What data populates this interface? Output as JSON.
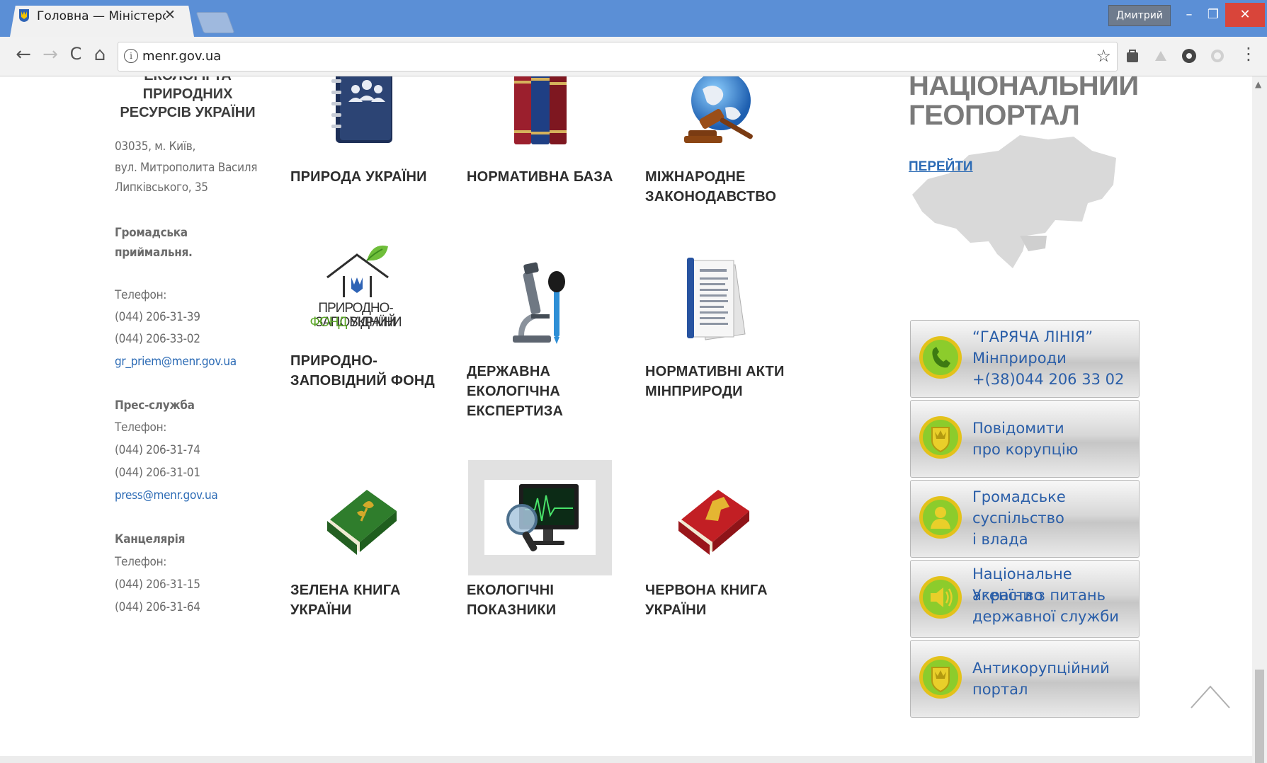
{
  "browser": {
    "tab_title": "Головна — Міністерство",
    "tab_close": "✕",
    "user_name": "Дмитрий",
    "window_minimize": "–",
    "window_restore": "❐",
    "window_close": "✕",
    "url": "menr.gov.ua",
    "nav": {
      "back": "←",
      "forward": "→",
      "reload": "C",
      "home": "⌂"
    },
    "info_glyph": "i",
    "star": "☆",
    "menu": "⋮"
  },
  "sidebar": {
    "org_name": "ЕКОЛОГІЇ ТА ПРИРОДНИХ РЕСУРСІВ УКРАЇНИ",
    "address_lines": [
      "03035, м. Київ,",
      "вул. Митрополита Василя",
      "Липківського, 35"
    ],
    "reception_title_1": "Громадська",
    "reception_title_2": "приймальня.",
    "phone_label": "Телефон:",
    "reception_phones": [
      "(044) 206-31-39",
      "(044) 206-33-02"
    ],
    "reception_email": "gr_priem@menr.gov.ua",
    "press_title": "Прес-служба",
    "press_phones": [
      "(044) 206-31-74",
      "(044) 206-31-01"
    ],
    "press_email": "press@menr.gov.ua",
    "office_title": "Канцелярія",
    "office_phones": [
      "(044) 206-31-15",
      "(044) 206-31-64"
    ]
  },
  "tiles": [
    {
      "label": "ПРИРОДА УКРАЇНИ",
      "icon": "address-book-icon"
    },
    {
      "label": "НОРМАТИВНА БАЗА",
      "icon": "books-icon"
    },
    {
      "label": "МІЖНАРОДНЕ ЗАКОНОДАВСТВО",
      "icon": "globe-gavel-icon"
    },
    {
      "label": "ПРИРОДНО-ЗАПОВІДНИЙ ФОНД",
      "icon": "reserve-fund-logo",
      "logo_line1": "ПРИРОДНО-ЗАПОВІДНИЙ",
      "logo_line2a": "ФОНД",
      "logo_line2b": " УКРАЇНИ"
    },
    {
      "label": "ДЕРЖАВНА ЕКОЛОГІЧНА ЕКСПЕРТИЗА",
      "icon": "microscope-icon"
    },
    {
      "label": "НОРМАТИВНІ АКТИ МІНПРИРОДИ",
      "icon": "documents-icon"
    },
    {
      "label": "ЗЕЛЕНА КНИГА УКРАЇНИ",
      "icon": "green-book-icon"
    },
    {
      "label": "ЕКОЛОГІЧНІ ПОКАЗНИКИ",
      "icon": "monitor-magnifier-icon"
    },
    {
      "label": "ЧЕРВОНА КНИГА УКРАЇНИ",
      "icon": "red-book-icon"
    }
  ],
  "geoportal": {
    "title_line1": "НАЦІОНАЛЬНИЙ",
    "title_line2": "ГЕОПОРТАЛ",
    "link": "ПЕРЕЙТИ"
  },
  "banners": [
    {
      "lines": [
        "“ГАРЯЧА ЛІНІЯ”",
        " Мінприроди",
        "+(38)044 206 33 02"
      ],
      "icon": "phone-icon"
    },
    {
      "lines": [
        "Повідомити",
        "про корупцію"
      ],
      "icon": "shield-icon"
    },
    {
      "lines": [
        "Громадське",
        "суспільство",
        "і влада"
      ],
      "icon": "person-icon"
    },
    {
      "lines": [
        "Національне агенство",
        "України з питань",
        "державної служби"
      ],
      "icon": "speaker-icon"
    },
    {
      "lines": [
        "Антикорупційний",
        "портал"
      ],
      "icon": "shield-icon"
    }
  ],
  "colors": {
    "tab_strip": "#5b8fd6",
    "link": "#2c6bb5",
    "banner_text": "#2a5ea8",
    "icon_green": "#8ccc2c",
    "icon_ring": "#e3c21a"
  }
}
